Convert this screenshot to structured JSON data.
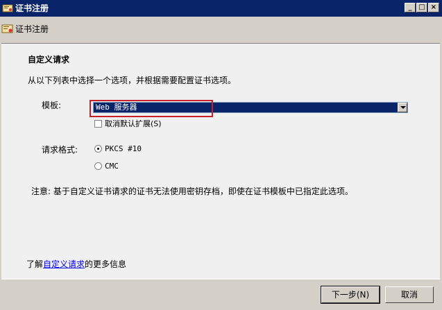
{
  "window": {
    "title": "证书注册",
    "controls": {
      "minimize": "_",
      "maximize": "□",
      "close": "×"
    }
  },
  "header": {
    "title": "证书注册"
  },
  "section": {
    "title": "自定义请求",
    "description": "从以下列表中选择一个选项，并根据需要配置证书选项。"
  },
  "template": {
    "label": "模板:",
    "selected": "Web 服务器",
    "checkbox_label": "取消默认扩展(S)",
    "checkbox_checked": false
  },
  "format": {
    "label": "请求格式:",
    "options": [
      {
        "label": "PKCS #10",
        "selected": true
      },
      {
        "label": "CMC",
        "selected": false
      }
    ]
  },
  "note": "注意: 基于自定义证书请求的证书无法使用密钥存档，即使在证书模板中已指定此选项。",
  "more_info": {
    "prefix": "了解",
    "link": "自定义请求",
    "suffix": "的更多信息"
  },
  "buttons": {
    "next": "下一步(N)",
    "cancel": "取消"
  },
  "colors": {
    "titlebar": "#0a246a",
    "highlight": "#c8202a",
    "link": "#0000ee"
  }
}
